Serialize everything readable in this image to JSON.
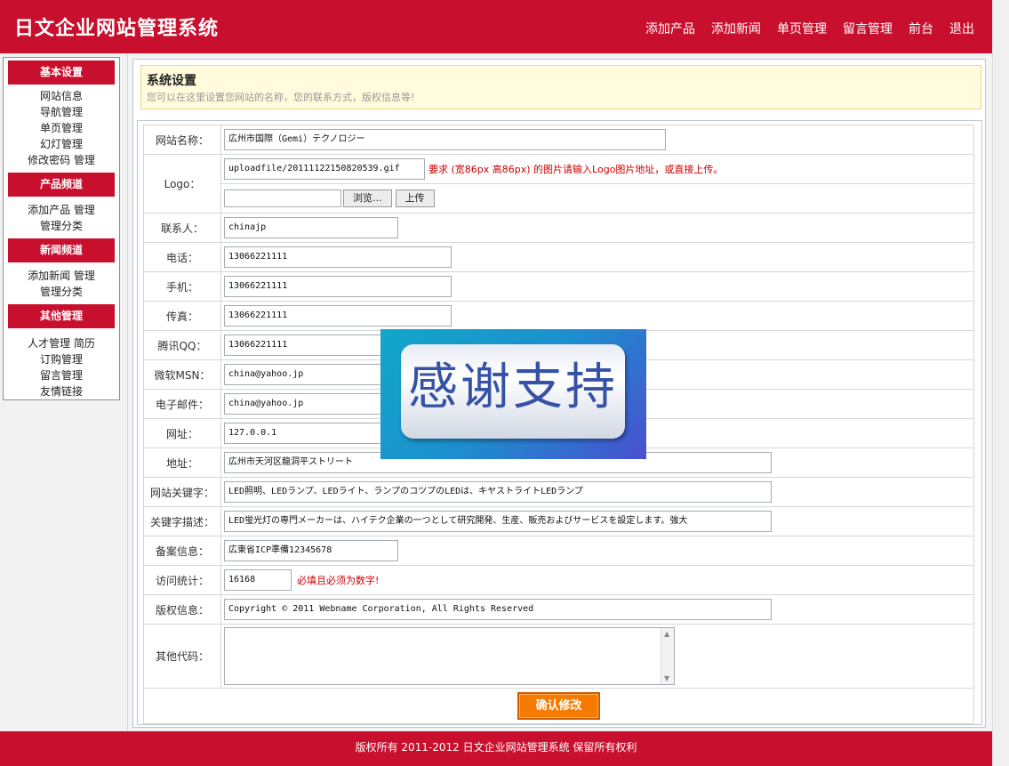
{
  "header": {
    "title": "日文企业网站管理系统",
    "nav": [
      "添加产品",
      "添加新闻",
      "单页管理",
      "留言管理",
      "前台",
      "退出"
    ]
  },
  "sidebar": {
    "sections": [
      {
        "title": "基本设置",
        "items": [
          "网站信息",
          "导航管理",
          "单页管理",
          "幻灯管理",
          "修改密码 管理"
        ]
      },
      {
        "title": "产品频道",
        "items": [
          "添加产品 管理",
          "管理分类"
        ]
      },
      {
        "title": "新闻频道",
        "items": [
          "添加新闻 管理",
          "管理分类"
        ]
      },
      {
        "title": "其他管理",
        "items": [
          "人才管理 简历",
          "订购管理",
          "留言管理",
          "友情链接"
        ]
      }
    ]
  },
  "info": {
    "title": "系统设置",
    "description": "您可以在这里设置您网站的名称，您的联系方式，版权信息等!"
  },
  "form": {
    "site_name": {
      "label": "网站名称：",
      "value": "広州市国際（Gemi）テクノロジー"
    },
    "logo": {
      "label": "Logo：",
      "value": "uploadfile/20111122150820539.gif",
      "note": "要求 (宽86px 高86px) 的图片请输入Logo图片地址，或直接上传。",
      "file_value": "",
      "browse_label": "浏览...",
      "upload_label": "上传"
    },
    "contact": {
      "label": "联系人：",
      "value": "chinajp"
    },
    "phone": {
      "label": "电话：",
      "value": "13066221111"
    },
    "mobile": {
      "label": "手机：",
      "value": "13066221111"
    },
    "fax": {
      "label": "传真：",
      "value": "13066221111"
    },
    "qq": {
      "label": "腾讯QQ：",
      "value": "13066221111"
    },
    "msn": {
      "label": "微软MSN：",
      "value": "china@yahoo.jp"
    },
    "email": {
      "label": "电子邮件：",
      "value": "china@yahoo.jp"
    },
    "url": {
      "label": "网址：",
      "value": "127.0.0.1"
    },
    "address": {
      "label": "地址：",
      "value": "広州市天河区龍洞平ストリート"
    },
    "keywords": {
      "label": "网站关键字：",
      "value": "LED照明、LEDランプ、LEDライト、ランプのコツプのLEDは、キヤストライトLEDランプ"
    },
    "description": {
      "label": "关键字描述：",
      "value": "LED蛍光灯の専門メーカーは、ハイテク企業の一つとして研究開発、生産、販売およびサービスを設定します。強大"
    },
    "icp": {
      "label": "备案信息：",
      "value": "広東省ICP準備12345678"
    },
    "stats": {
      "label": "访问统计：",
      "value": "16168",
      "note": "必填且必须为数字!"
    },
    "copyright": {
      "label": "版权信息：",
      "value": "Copyright © 2011 Webname Corporation, All Rights Reserved"
    },
    "other_code": {
      "label": "其他代码：",
      "value": ""
    },
    "submit_label": "确认修改"
  },
  "overlay": {
    "text": "感谢支持"
  },
  "footer": {
    "text": "版权所有 2011-2012 日文企业网站管理系统 保留所有权利"
  }
}
